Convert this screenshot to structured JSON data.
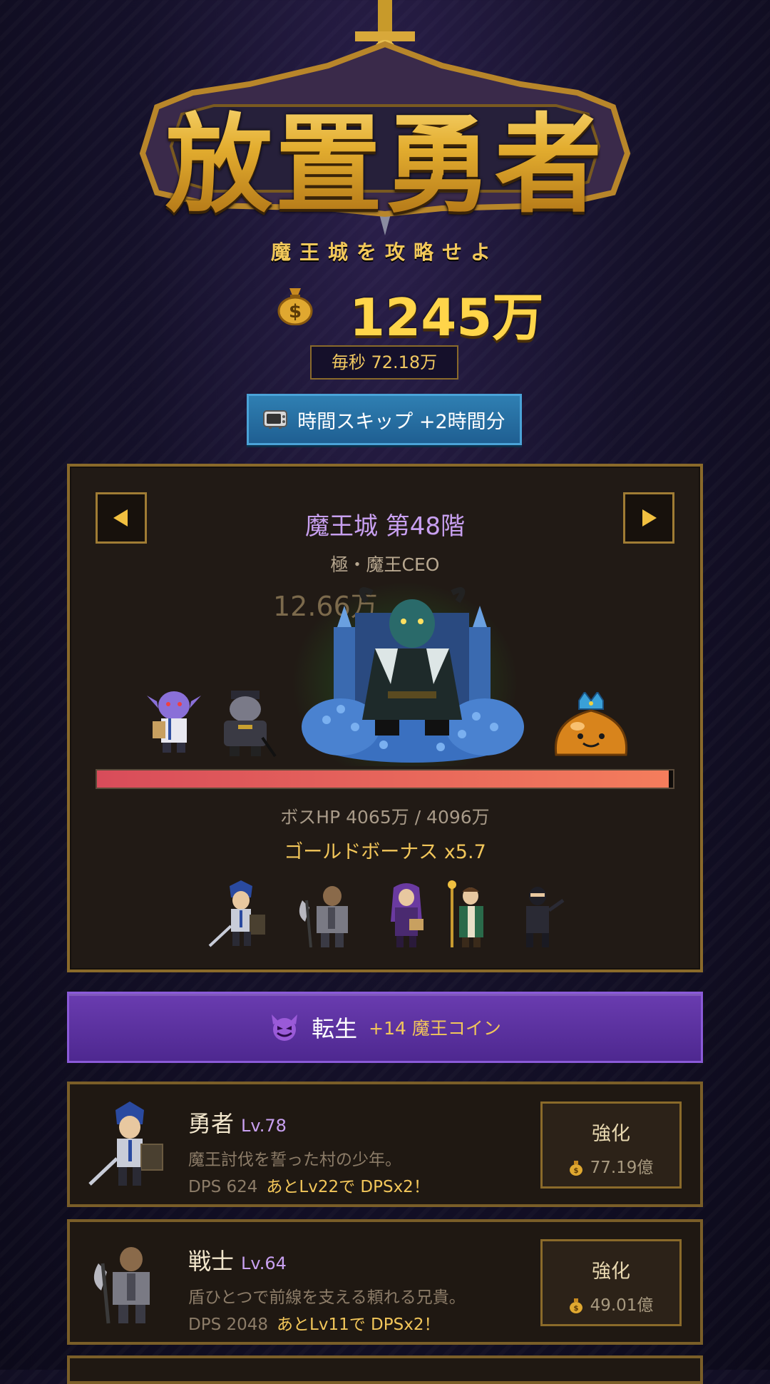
{
  "header": {
    "title": "放置勇者",
    "subtitle": "魔王城を攻略せよ"
  },
  "currency": {
    "gold": "1245万",
    "per_second": "毎秒 72.18万"
  },
  "time_skip": {
    "label": "時間スキップ +2時間分",
    "icon": "tv-icon"
  },
  "battle": {
    "floor_title": "魔王城 第48階",
    "boss_name": "極・魔王CEO",
    "damage_text": "12.66万",
    "boss_hp_text": "ボスHP 4065万 / 4096万",
    "boss_hp_current": 4065,
    "boss_hp_max": 4096,
    "gold_bonus": "ゴールドボーナス x5.7",
    "prev_icon": "arrow-left-icon",
    "next_icon": "arrow-right-icon",
    "colors": {
      "hp_start": "#d84c5a",
      "hp_end": "#f47d5c",
      "title": "#c8a0f0"
    }
  },
  "rebirth": {
    "icon": "devil-face-icon",
    "label": "転生",
    "reward": "+14 魔王コイン"
  },
  "heroes": [
    {
      "name": "勇者",
      "level": "Lv.78",
      "description": "魔王討伐を誓った村の少年。",
      "dps": "DPS 624",
      "milestone": "あとLv22で DPSx2！",
      "upgrade_label": "強化",
      "upgrade_cost": "77.19億"
    },
    {
      "name": "戦士",
      "level": "Lv.64",
      "description": "盾ひとつで前線を支える頼れる兄貴。",
      "dps": "DPS 2048",
      "milestone": "あとLv11で DPSx2！",
      "upgrade_label": "強化",
      "upgrade_cost": "49.01億"
    }
  ]
}
